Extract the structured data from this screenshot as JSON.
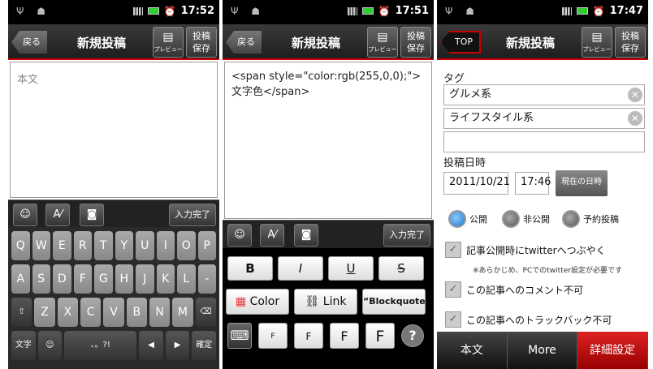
{
  "status": {
    "t1": "17:52",
    "t2": "17:51",
    "t3": "17:47"
  },
  "p1": {
    "back": "戻る",
    "title": "新規投稿",
    "preview": "プレビュー",
    "save1": "投稿",
    "save2": "保存",
    "placeholder": "本文",
    "done": "入力完了",
    "rows": [
      [
        "Q",
        "W",
        "E",
        "R",
        "T",
        "Y",
        "U",
        "I",
        "O",
        "P"
      ],
      [
        "A",
        "S",
        "D",
        "F",
        "G",
        "H",
        "J",
        "K",
        "L",
        "-"
      ],
      [
        "⇧",
        "Z",
        "X",
        "C",
        "V",
        "B",
        "N",
        "M",
        "⌫"
      ],
      [
        "文字",
        "☺",
        "、。?!",
        "◀",
        "▶",
        "確定"
      ]
    ]
  },
  "p2": {
    "back": "戻る",
    "title": "新規投稿",
    "preview": "プレビュー",
    "save1": "投稿",
    "save2": "保存",
    "code": "<span style=\"color:rgb(255,0,0);\">文字色</span>",
    "done": "入力完了",
    "bold": "B",
    "italic": "I",
    "underline": "U",
    "strike": "S",
    "color": "Color",
    "link": "Link",
    "quote": "Blockquote",
    "f": "F",
    "help": "?"
  },
  "p3": {
    "top": "TOP",
    "title": "新規投稿",
    "preview": "プレビュー",
    "save1": "投稿",
    "save2": "保存",
    "tag_label": "タグ",
    "tags": [
      "グルメ系",
      "ライフスタイル系",
      ""
    ],
    "date_label": "投稿日時",
    "date": "2011/10/21",
    "time": "17:46",
    "now": "現在の日時",
    "radios": [
      "公開",
      "非公開",
      "予約投稿"
    ],
    "c1": "記事公開時にtwitterへつぶやく",
    "note": "※あらかじめ、PCでのtwitter設定が必要です",
    "c2": "この記事へのコメント不可",
    "c3": "この記事へのトラックバック不可",
    "tabs": [
      "本文",
      "More",
      "詳細設定"
    ]
  }
}
